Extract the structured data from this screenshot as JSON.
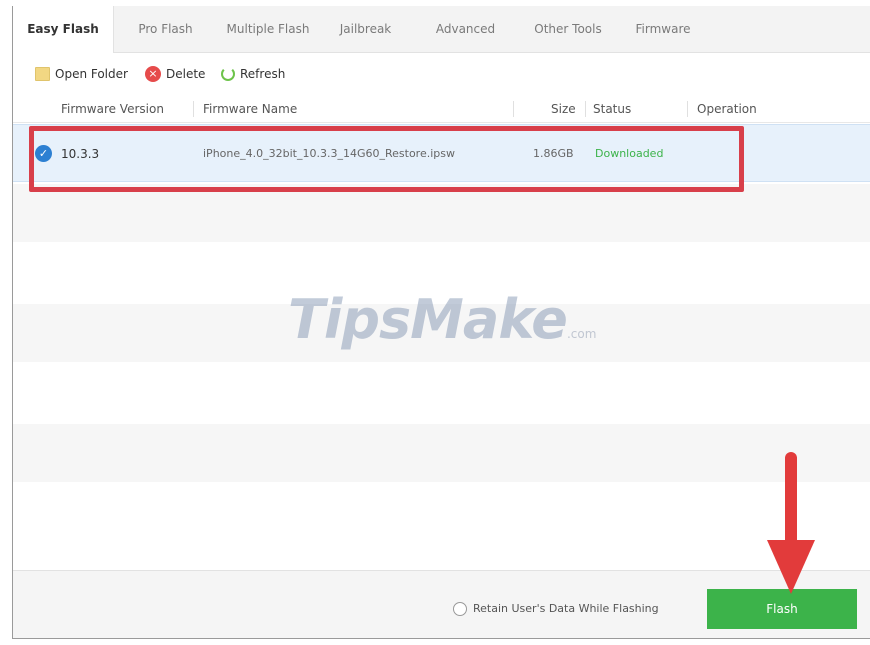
{
  "tabs": [
    {
      "label": "Easy Flash",
      "active": true
    },
    {
      "label": "Pro Flash",
      "active": false
    },
    {
      "label": "Multiple Flash",
      "active": false
    },
    {
      "label": "Jailbreak",
      "active": false
    },
    {
      "label": "Advanced",
      "active": false
    },
    {
      "label": "Other Tools",
      "active": false
    },
    {
      "label": "Firmware",
      "active": false
    }
  ],
  "toolbar": {
    "open_folder": "Open Folder",
    "delete": "Delete",
    "refresh": "Refresh"
  },
  "table": {
    "columns": {
      "firmware_version": "Firmware Version",
      "firmware_name": "Firmware Name",
      "size": "Size",
      "status": "Status",
      "operation": "Operation"
    },
    "rows": [
      {
        "version": "10.3.3",
        "name": "iPhone_4.0_32bit_10.3.3_14G60_Restore.ipsw",
        "size": "1.86GB",
        "status": "Downloaded",
        "selected": true
      }
    ]
  },
  "watermark": {
    "main": "TipsMake",
    "suffix": ".com"
  },
  "footer": {
    "retain_label": "Retain User's Data While Flashing",
    "retain_checked": false,
    "flash_label": "Flash"
  },
  "colors": {
    "status_green": "#3cb34a",
    "selection_blue": "#2d80d2",
    "annotation_red": "#d83f4a",
    "flash_button": "#3cb34a"
  }
}
